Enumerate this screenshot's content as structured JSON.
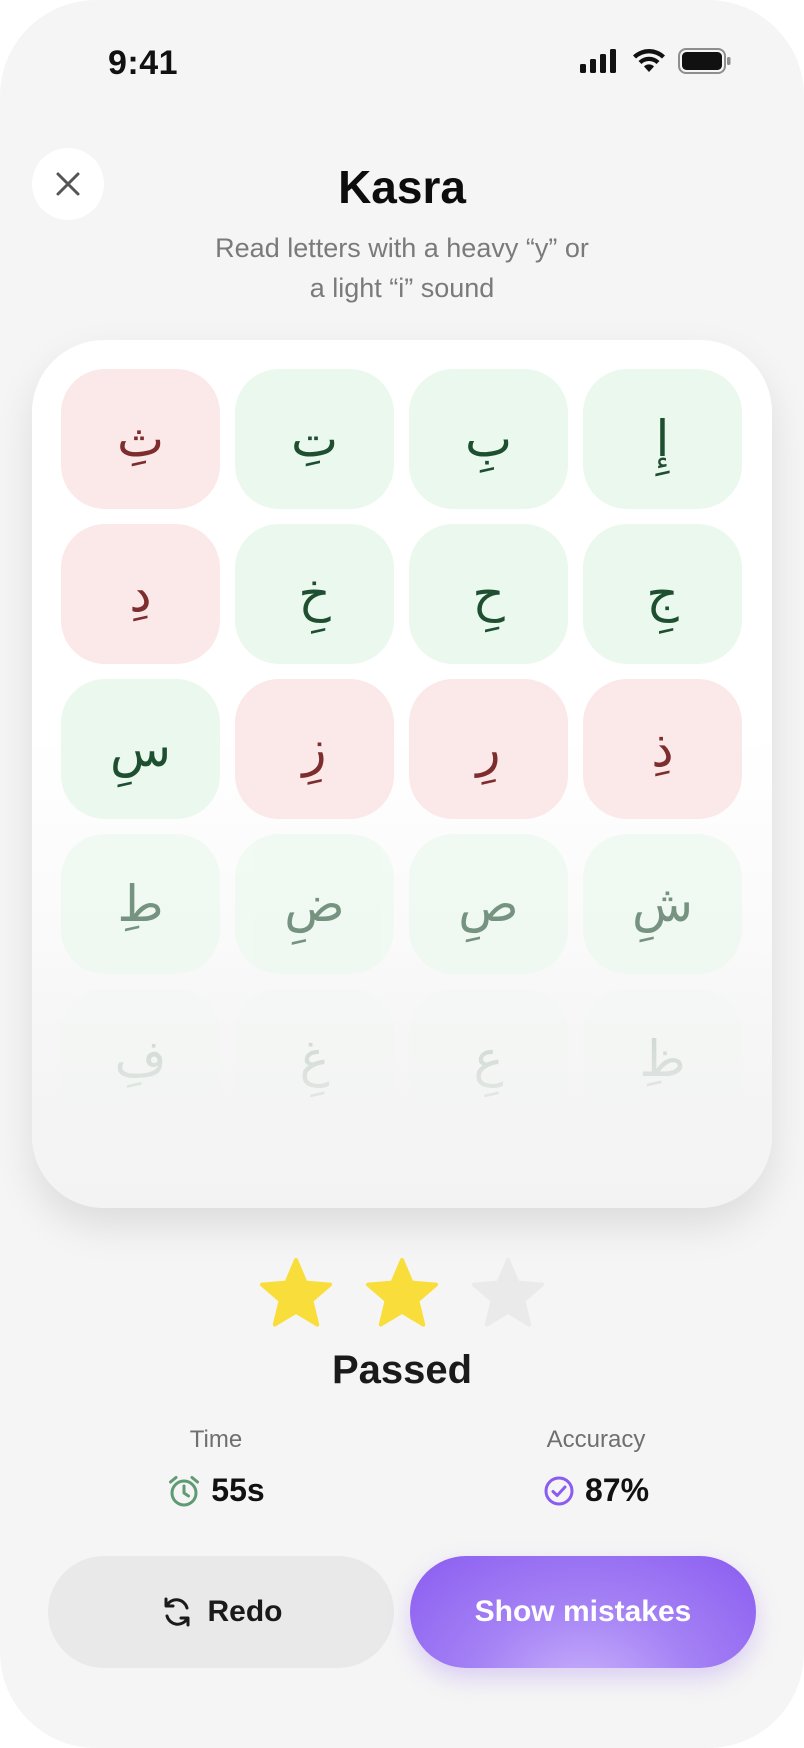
{
  "status_bar": {
    "time": "9:41"
  },
  "header": {
    "title": "Kasra",
    "subtitle_line1": "Read letters with a heavy “y” or",
    "subtitle_line2": "a light “i” sound"
  },
  "letters": [
    {
      "char": "ثِ",
      "status": "wrong"
    },
    {
      "char": "تِ",
      "status": "correct"
    },
    {
      "char": "بِ",
      "status": "correct"
    },
    {
      "char": "إِ",
      "status": "correct"
    },
    {
      "char": "دِ",
      "status": "wrong"
    },
    {
      "char": "خِ",
      "status": "correct"
    },
    {
      "char": "حِ",
      "status": "correct"
    },
    {
      "char": "جِ",
      "status": "correct"
    },
    {
      "char": "سِ",
      "status": "correct"
    },
    {
      "char": "زِ",
      "status": "wrong"
    },
    {
      "char": "رِ",
      "status": "wrong"
    },
    {
      "char": "ذِ",
      "status": "wrong"
    },
    {
      "char": "طِ",
      "status": "correct"
    },
    {
      "char": "ضِ",
      "status": "correct"
    },
    {
      "char": "صِ",
      "status": "correct"
    },
    {
      "char": "شِ",
      "status": "correct"
    },
    {
      "char": "فِ",
      "status": "correct"
    },
    {
      "char": "غِ",
      "status": "correct"
    },
    {
      "char": "عِ",
      "status": "correct"
    },
    {
      "char": "ظِ",
      "status": "correct"
    }
  ],
  "rating": {
    "stars_earned": 2,
    "stars_total": 3
  },
  "result_label": "Passed",
  "stats": {
    "time": {
      "label": "Time",
      "value": "55s"
    },
    "accuracy": {
      "label": "Accuracy",
      "value": "87%"
    }
  },
  "actions": {
    "redo_label": "Redo",
    "show_mistakes_label": "Show mistakes"
  },
  "colors": {
    "correct_bg": "#ebf8ee",
    "wrong_bg": "#fbe8e8",
    "star_filled": "#f9de3b",
    "star_empty": "#eaeaea",
    "accent_purple": "#8a5cf0"
  }
}
